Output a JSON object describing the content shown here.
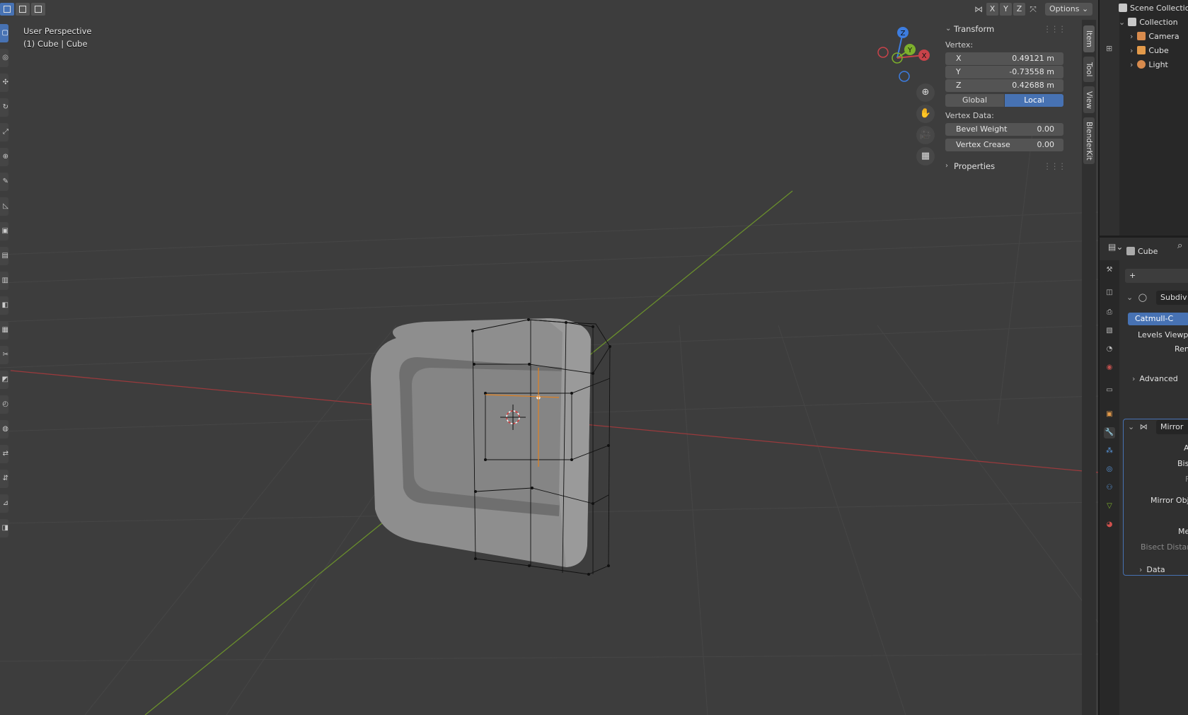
{
  "viewport": {
    "info_line1": "User Perspective",
    "info_line2": "(1) Cube | Cube",
    "header": {
      "axis_x": "X",
      "axis_y": "Y",
      "axis_z": "Z",
      "options_label": "Options",
      "options_chevron": "⌄"
    },
    "gizmo": {
      "z": "Z",
      "y": "Y",
      "x": "X"
    },
    "nav": {
      "zoom": "⊕",
      "pan": "✋",
      "camera": "🎥",
      "grid": "▦"
    }
  },
  "npanel": {
    "transform": {
      "title": "Transform",
      "vertex_label": "Vertex:",
      "x_label": "X",
      "x_value": "0.49121 m",
      "y_label": "Y",
      "y_value": "-0.73558 m",
      "z_label": "Z",
      "z_value": "0.42688 m",
      "global_label": "Global",
      "local_label": "Local",
      "vertex_data_label": "Vertex Data:",
      "bevel_weight_label": "Bevel Weight",
      "bevel_weight_value": "0.00",
      "vertex_crease_label": "Vertex Crease",
      "vertex_crease_value": "0.00"
    },
    "properties": {
      "title": "Properties"
    },
    "chev_down": "⌄",
    "chev_right": "›",
    "grip": "⋮⋮⋮"
  },
  "side_tabs": {
    "item": "Item",
    "tool": "Tool",
    "view": "View",
    "blenderkit": "BlenderKit"
  },
  "outliner": {
    "scene_collection": "Scene Collection",
    "collection": "Collection",
    "camera": "Camera",
    "cube": "Cube",
    "light": "Light"
  },
  "properties_editor": {
    "object_name": "Cube",
    "add_modifier": "+",
    "subdiv_name": "Subdiv",
    "catmull_label": "Catmull-C",
    "levels_viewport_label": "Levels Viewp",
    "render_label": "Rend",
    "advanced_label": "Advanced",
    "mirror_name": "Mirror",
    "axis_label": "A",
    "bisect_label": "Bis",
    "flip_label": "F",
    "mirror_object_label": "Mirror Obj",
    "merge_label": "Me",
    "bisect_distance_label": "Bisect Distar",
    "data_label": "Data"
  },
  "colors": {
    "viewport_bg": "#3d3d3d",
    "accent": "#4772b3",
    "x_axis": "#c8434a",
    "y_axis": "#7db02c",
    "z_axis": "#3d7de0"
  }
}
